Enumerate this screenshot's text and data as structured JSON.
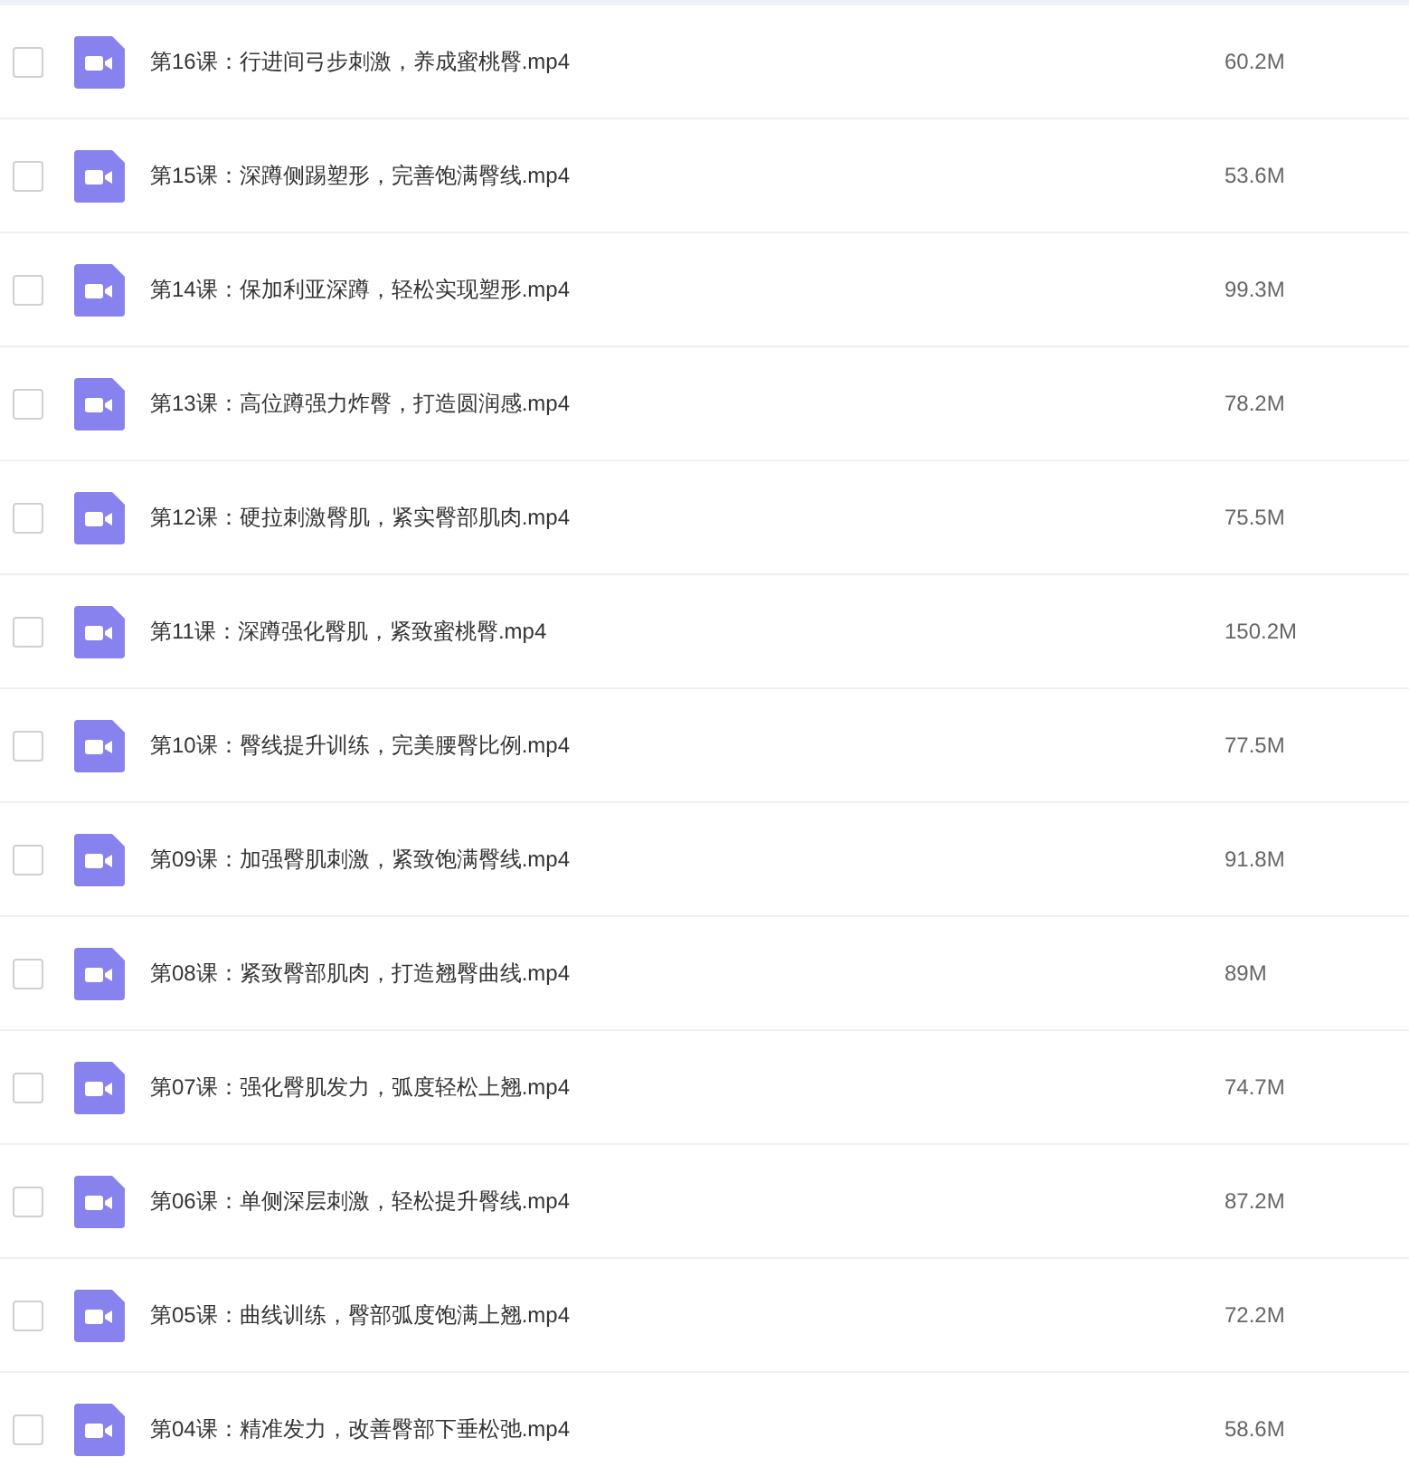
{
  "files": [
    {
      "name": "第16课：行进间弓步刺激，养成蜜桃臀.mp4",
      "size": "60.2M",
      "checked": false
    },
    {
      "name": "第15课：深蹲侧踢塑形，完善饱满臀线.mp4",
      "size": "53.6M",
      "checked": false
    },
    {
      "name": "第14课：保加利亚深蹲，轻松实现塑形.mp4",
      "size": "99.3M",
      "checked": false
    },
    {
      "name": "第13课：高位蹲强力炸臀，打造圆润感.mp4",
      "size": "78.2M",
      "checked": false
    },
    {
      "name": "第12课：硬拉刺激臀肌，紧实臀部肌肉.mp4",
      "size": "75.5M",
      "checked": false
    },
    {
      "name": "第11课：深蹲强化臀肌，紧致蜜桃臀.mp4",
      "size": "150.2M",
      "checked": false
    },
    {
      "name": "第10课：臀线提升训练，完美腰臀比例.mp4",
      "size": "77.5M",
      "checked": false
    },
    {
      "name": "第09课：加强臀肌刺激，紧致饱满臀线.mp4",
      "size": "91.8M",
      "checked": false
    },
    {
      "name": "第08课：紧致臀部肌肉，打造翘臀曲线.mp4",
      "size": "89M",
      "checked": false
    },
    {
      "name": "第07课：强化臀肌发力，弧度轻松上翘.mp4",
      "size": "74.7M",
      "checked": false
    },
    {
      "name": "第06课：单侧深层刺激，轻松提升臀线.mp4",
      "size": "87.2M",
      "checked": false
    },
    {
      "name": "第05课：曲线训练，臀部弧度饱满上翘.mp4",
      "size": "72.2M",
      "checked": false
    },
    {
      "name": "第04课：精准发力，改善臀部下垂松弛.mp4",
      "size": "58.6M",
      "checked": false
    }
  ]
}
